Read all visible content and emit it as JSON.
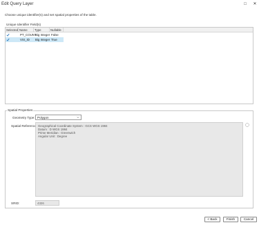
{
  "window": {
    "title": "Edit Query Layer",
    "maximize_glyph": "□",
    "close_glyph": "✕"
  },
  "instructions": "Choose unique identifier(s) and set spatial properties of the table.",
  "unique_id": {
    "label": "Unique Identifier Field(s)",
    "columns": [
      "Selected",
      "Name",
      "Type",
      "Nullable"
    ],
    "rows": [
      {
        "selected": true,
        "name": "PT_COUNT",
        "type": "Big Integer",
        "nullable": "False",
        "highlighted": false
      },
      {
        "selected": true,
        "name": "VSI_ID",
        "type": "Big Integer",
        "nullable": "True",
        "highlighted": true
      }
    ]
  },
  "spatial": {
    "legend": "Spatial Properties",
    "geometry_type_label": "Geometry Type:",
    "geometry_type_value": "Polygon",
    "spatial_reference_label": "Spatial Reference:",
    "spatial_reference_lines": [
      "Geographical Coordinate System : GCS WGS 1984",
      "Datum : D WGS 1984",
      "Prime Meridian : Greenwich",
      "Angular Unit : Degree"
    ],
    "srid_label": "SRID:",
    "srid_value": "4326"
  },
  "buttons": {
    "back": "< Back",
    "finish": "Finish",
    "cancel": "Cancel"
  },
  "colors": {
    "selected_row": "#cde8f7",
    "check": "#1e6fb8"
  }
}
